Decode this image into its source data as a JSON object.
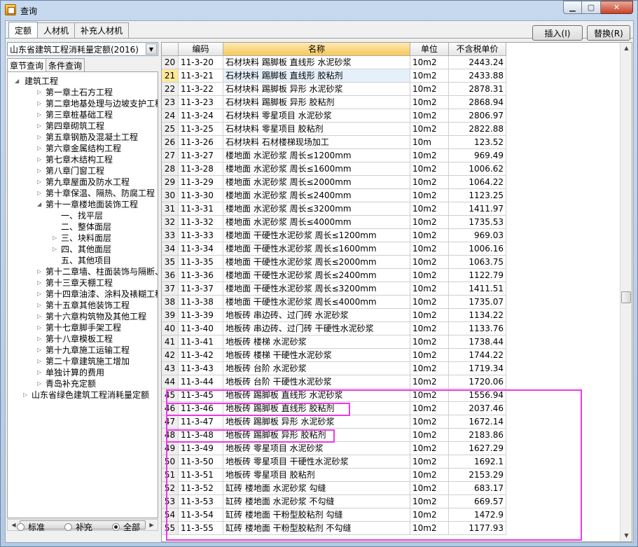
{
  "window": {
    "title": "查询"
  },
  "top_tabs": [
    "定额",
    "人材机",
    "补充人材机"
  ],
  "buttons": {
    "insert": "插入(I)",
    "replace": "替换(R)"
  },
  "quota_combo": "山东省建筑工程消耗量定额(2016)",
  "sub_tabs": [
    "章节查询",
    "条件查询"
  ],
  "tree": {
    "root": "建筑工程",
    "chapters": [
      "第一章土石方工程",
      "第二章地基处理与边坡支护工程",
      "第三章桩基础工程",
      "第四章砌筑工程",
      "第五章钢筋及混凝土工程",
      "第六章金属结构工程",
      "第七章木结构工程",
      "第八章门窗工程",
      "第九章屋面及防水工程",
      "第十章保温、隔热、防腐工程",
      "第十一章楼地面装饰工程"
    ],
    "ch11_children": [
      "一、找平层",
      "二、整体面层",
      "三、块料面层",
      "四、其他面层",
      "五、其他项目"
    ],
    "chapters_after": [
      "第十二章墙、柱面装饰与隔断、",
      "第十三章天棚工程",
      "第十四章油漆、涂料及裱糊工程",
      "第十五章其他装饰工程",
      "第十六章构筑物及其他工程",
      "第十七章脚手架工程",
      "第十八章模板工程",
      "第十九章施工运输工程",
      "第二十章建筑施工增加",
      "单独计算的费用",
      "青岛补充定额"
    ],
    "other_root": "山东省绿色建筑工程消耗量定额"
  },
  "radios": {
    "standard": "标准",
    "supplement": "补充",
    "all": "全部"
  },
  "grid": {
    "headers": {
      "code": "编码",
      "name": "名称",
      "unit": "单位",
      "price": "不含税单价"
    },
    "rows": [
      {
        "n": "20",
        "code": "11-3-20",
        "name": "石材块料 踢脚板 直线形 水泥砂浆",
        "unit": "10m2",
        "price": "2443.24"
      },
      {
        "n": "21",
        "code": "11-3-21",
        "name": "石材块料 踢脚板 直线形 胶粘剂",
        "unit": "10m2",
        "price": "2433.88"
      },
      {
        "n": "22",
        "code": "11-3-22",
        "name": "石材块料 踢脚板 异形 水泥砂浆",
        "unit": "10m2",
        "price": "2878.31"
      },
      {
        "n": "23",
        "code": "11-3-23",
        "name": "石材块料 踢脚板 异形 胶粘剂",
        "unit": "10m2",
        "price": "2868.94"
      },
      {
        "n": "24",
        "code": "11-3-24",
        "name": "石材块料 零星项目 水泥砂浆",
        "unit": "10m2",
        "price": "2806.97"
      },
      {
        "n": "25",
        "code": "11-3-25",
        "name": "石材块料 零星项目 胶粘剂",
        "unit": "10m2",
        "price": "2822.88"
      },
      {
        "n": "26",
        "code": "11-3-26",
        "name": "石材块料 石材楼梯现场加工",
        "unit": "10m",
        "price": "123.52"
      },
      {
        "n": "27",
        "code": "11-3-27",
        "name": "楼地面 水泥砂浆 周长≤1200mm",
        "unit": "10m2",
        "price": "969.49"
      },
      {
        "n": "28",
        "code": "11-3-28",
        "name": "楼地面 水泥砂浆 周长≤1600mm",
        "unit": "10m2",
        "price": "1006.62"
      },
      {
        "n": "29",
        "code": "11-3-29",
        "name": "楼地面 水泥砂浆 周长≤2000mm",
        "unit": "10m2",
        "price": "1064.22"
      },
      {
        "n": "30",
        "code": "11-3-30",
        "name": "楼地面 水泥砂浆 周长≤2400mm",
        "unit": "10m2",
        "price": "1123.25"
      },
      {
        "n": "31",
        "code": "11-3-31",
        "name": "楼地面 水泥砂浆 周长≤3200mm",
        "unit": "10m2",
        "price": "1411.97"
      },
      {
        "n": "32",
        "code": "11-3-32",
        "name": "楼地面 水泥砂浆 周长≤4000mm",
        "unit": "10m2",
        "price": "1735.53"
      },
      {
        "n": "33",
        "code": "11-3-33",
        "name": "楼地面 干硬性水泥砂浆 周长≤1200mm",
        "unit": "10m2",
        "price": "969.03"
      },
      {
        "n": "34",
        "code": "11-3-34",
        "name": "楼地面 干硬性水泥砂浆 周长≤1600mm",
        "unit": "10m2",
        "price": "1006.16"
      },
      {
        "n": "35",
        "code": "11-3-35",
        "name": "楼地面 干硬性水泥砂浆 周长≤2000mm",
        "unit": "10m2",
        "price": "1063.75"
      },
      {
        "n": "36",
        "code": "11-3-36",
        "name": "楼地面 干硬性水泥砂浆 周长≤2400mm",
        "unit": "10m2",
        "price": "1122.79"
      },
      {
        "n": "37",
        "code": "11-3-37",
        "name": "楼地面 干硬性水泥砂浆 周长≤3200mm",
        "unit": "10m2",
        "price": "1411.51"
      },
      {
        "n": "38",
        "code": "11-3-38",
        "name": "楼地面 干硬性水泥砂浆 周长≤4000mm",
        "unit": "10m2",
        "price": "1735.07"
      },
      {
        "n": "39",
        "code": "11-3-39",
        "name": "地板砖 串边砖、过门砖 水泥砂浆",
        "unit": "10m2",
        "price": "1134.22"
      },
      {
        "n": "40",
        "code": "11-3-40",
        "name": "地板砖 串边砖、过门砖 干硬性水泥砂浆",
        "unit": "10m2",
        "price": "1133.76"
      },
      {
        "n": "41",
        "code": "11-3-41",
        "name": "地板砖 楼梯 水泥砂浆",
        "unit": "10m2",
        "price": "1738.44"
      },
      {
        "n": "42",
        "code": "11-3-42",
        "name": "地板砖 楼梯 干硬性水泥砂浆",
        "unit": "10m2",
        "price": "1744.22"
      },
      {
        "n": "43",
        "code": "11-3-43",
        "name": "地板砖 台阶 水泥砂浆",
        "unit": "10m2",
        "price": "1719.34"
      },
      {
        "n": "44",
        "code": "11-3-44",
        "name": "地板砖 台阶 干硬性水泥砂浆",
        "unit": "10m2",
        "price": "1720.06"
      },
      {
        "n": "45",
        "code": "11-3-45",
        "name": "地板砖 踢脚板 直线形 水泥砂浆",
        "unit": "10m2",
        "price": "1556.94"
      },
      {
        "n": "46",
        "code": "11-3-46",
        "name": "地板砖 踢脚板 直线形 胶粘剂",
        "unit": "10m2",
        "price": "2037.46"
      },
      {
        "n": "47",
        "code": "11-3-47",
        "name": "地板砖 踢脚板 异形 水泥砂浆",
        "unit": "10m2",
        "price": "1672.14"
      },
      {
        "n": "48",
        "code": "11-3-48",
        "name": "地板砖 踢脚板 异形 胶粘剂",
        "unit": "10m2",
        "price": "2183.86"
      },
      {
        "n": "49",
        "code": "11-3-49",
        "name": "地板砖 零星项目 水泥砂浆",
        "unit": "10m2",
        "price": "1627.29"
      },
      {
        "n": "50",
        "code": "11-3-50",
        "name": "地板砖 零星项目 干硬性水泥砂浆",
        "unit": "10m2",
        "price": "1692.1"
      },
      {
        "n": "51",
        "code": "11-3-51",
        "name": "地板砖 零星项目 胶粘剂",
        "unit": "10m2",
        "price": "2153.29"
      },
      {
        "n": "52",
        "code": "11-3-52",
        "name": "缸砖 楼地面 水泥砂浆 勾缝",
        "unit": "10m2",
        "price": "683.17"
      },
      {
        "n": "53",
        "code": "11-3-53",
        "name": "缸砖 楼地面 水泥砂浆 不勾缝",
        "unit": "10m2",
        "price": "669.57"
      },
      {
        "n": "54",
        "code": "11-3-54",
        "name": "缸砖 楼地面 干粉型胶粘剂 勾缝",
        "unit": "10m2",
        "price": "1472.9"
      },
      {
        "n": "55",
        "code": "11-3-55",
        "name": "缸砖 楼地面 干粉型胶粘剂 不勾缝",
        "unit": "10m2",
        "price": "1177.93"
      }
    ]
  }
}
